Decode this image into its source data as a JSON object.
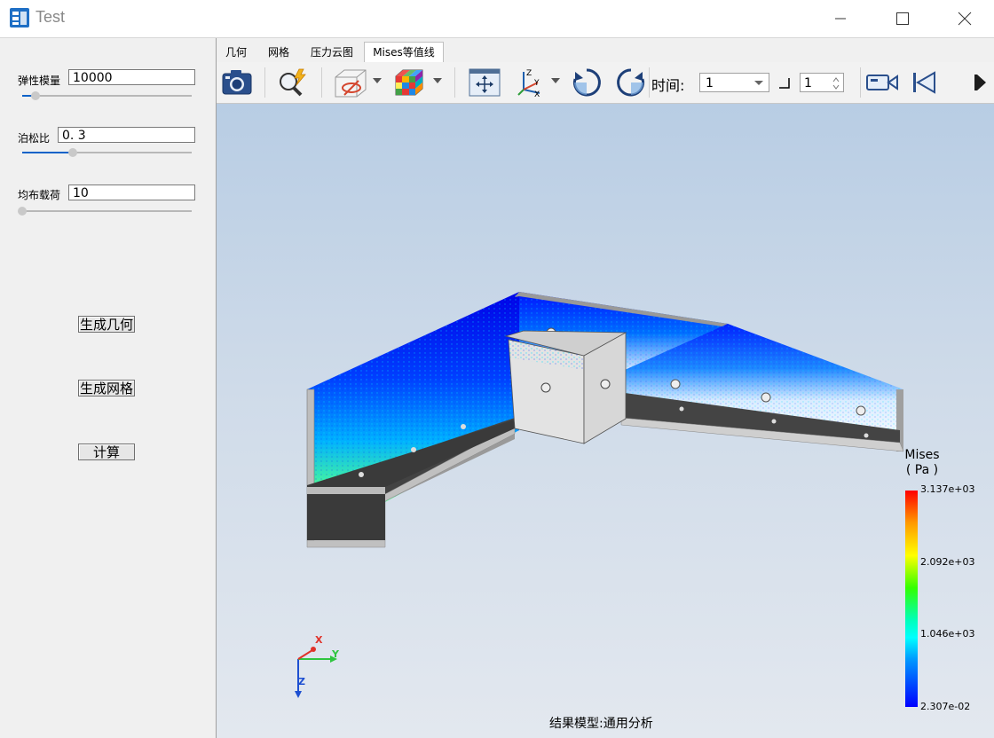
{
  "window": {
    "title": "Test",
    "controls": [
      "minimize-icon",
      "maximize-icon",
      "close-icon"
    ]
  },
  "params": {
    "elastic_modulus": {
      "label": "弹性模量",
      "value": "10000",
      "slider": 0.08
    },
    "poisson_ratio": {
      "label": "泊松比",
      "value": "0. 3",
      "slider": 0.3
    },
    "uniform_load": {
      "label": "均布载荷",
      "value": "10",
      "slider": 0.0
    }
  },
  "buttons": {
    "generate_geometry": "生成几何",
    "generate_mesh": "生成网格",
    "compute": "计算"
  },
  "tabs": [
    "几何",
    "网格",
    "压力云图",
    "Mises等值线"
  ],
  "active_tab": "Mises等值线",
  "toolbar": {
    "icons": [
      "camera-icon",
      "zoom-icon",
      "hide-show-icon",
      "color-cube-icon",
      "fit-view-icon",
      "axes-view-icon",
      "rotate-cw-icon",
      "rotate-ccw-icon",
      "video-camera-icon",
      "first-frame-icon",
      "next-icon"
    ],
    "time_label": "时间:",
    "time_value": "1",
    "step_value": "1"
  },
  "legend": {
    "title_line1": "Mises",
    "title_line2": "( Pa )",
    "labels": [
      "3.137e+03",
      "2.092e+03",
      "1.046e+03",
      "2.307e-02"
    ],
    "colors": [
      "#ff0000",
      "#ffff00",
      "#00ff00",
      "#00ffff",
      "#0000ff"
    ]
  },
  "axes": {
    "x": "X",
    "y": "Y",
    "z": "Z"
  },
  "status": "结果模型:通用分析"
}
